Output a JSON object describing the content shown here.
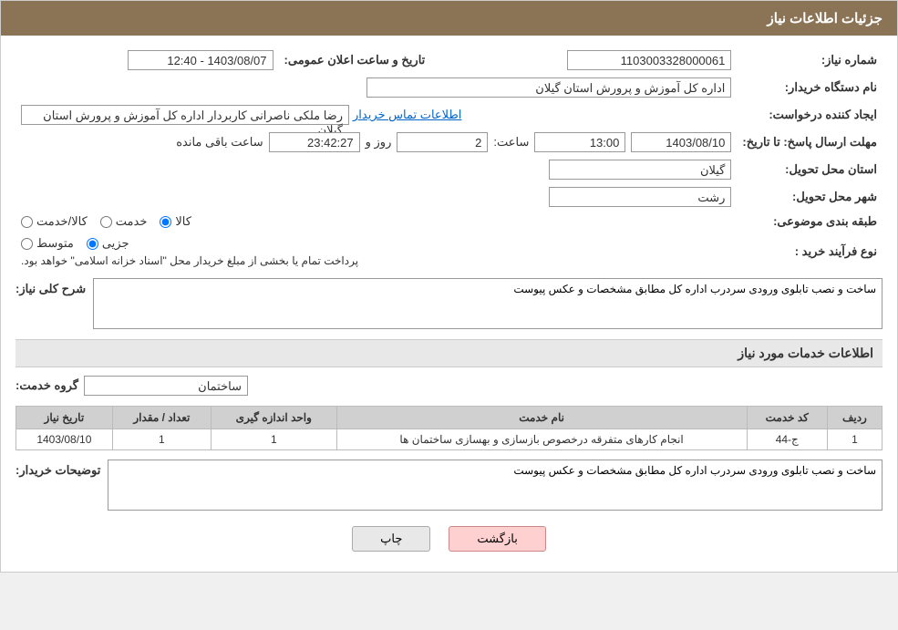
{
  "header": {
    "title": "جزئیات اطلاعات نیاز"
  },
  "fields": {
    "need_number_label": "شماره نیاز:",
    "need_number_value": "1103003328000061",
    "buyer_org_label": "نام دستگاه خریدار:",
    "buyer_org_value": "اداره کل آموزش و پرورش استان گیلان",
    "creator_label": "ایجاد کننده درخواست:",
    "creator_value": "رضا ملکی ناصرانی کاربردار اداره کل آموزش و پرورش استان گیلان",
    "contact_link": "اطلاعات تماس خریدار",
    "deadline_label": "مهلت ارسال پاسخ: تا تاریخ:",
    "deadline_date": "1403/08/10",
    "deadline_time_label": "ساعت:",
    "deadline_time": "13:00",
    "deadline_days_label": "روز و",
    "deadline_days": "2",
    "deadline_remaining_label": "ساعت باقی مانده",
    "deadline_remaining": "23:42:27",
    "announce_label": "تاریخ و ساعت اعلان عمومی:",
    "announce_value": "1403/08/07 - 12:40",
    "province_label": "استان محل تحویل:",
    "province_value": "گیلان",
    "city_label": "شهر محل تحویل:",
    "city_value": "رشت",
    "category_label": "طبقه بندی موضوعی:",
    "category_kala": "کالا",
    "category_khedmat": "خدمت",
    "category_kala_khedmat": "کالا/خدمت",
    "purchase_type_label": "نوع فرآیند خرید :",
    "purchase_jozii": "جزیی",
    "purchase_motavaset": "متوسط",
    "purchase_notice": "پرداخت تمام یا بخشی از مبلغ خریدار محل \"اسناد خزانه اسلامی\" خواهد بود.",
    "description_label": "شرح کلی نیاز:",
    "description_value": "ساخت و نصب تابلوی ورودی سردرب اداره کل مطابق مشخصات و عکس پیوست",
    "services_section_label": "اطلاعات خدمات مورد نیاز",
    "service_group_label": "گروه خدمت:",
    "service_group_value": "ساختمان",
    "table": {
      "col_row": "ردیف",
      "col_code": "کد خدمت",
      "col_name": "نام خدمت",
      "col_unit": "واحد اندازه گیری",
      "col_qty": "تعداد / مقدار",
      "col_date": "تاریخ نیاز",
      "rows": [
        {
          "row": "1",
          "code": "ج-44",
          "name": "انجام کارهای متفرقه درخصوص بازسازی و بهسازی ساختمان ها",
          "unit": "1",
          "qty": "1",
          "date": "1403/08/10"
        }
      ]
    },
    "buyer_desc_label": "توضیحات خریدار:",
    "buyer_desc_value": "ساخت و نصب تابلوی ورودی سردرب اداره کل مطابق مشخصات و عکس پیوست"
  },
  "buttons": {
    "print": "چاپ",
    "back": "بازگشت"
  }
}
